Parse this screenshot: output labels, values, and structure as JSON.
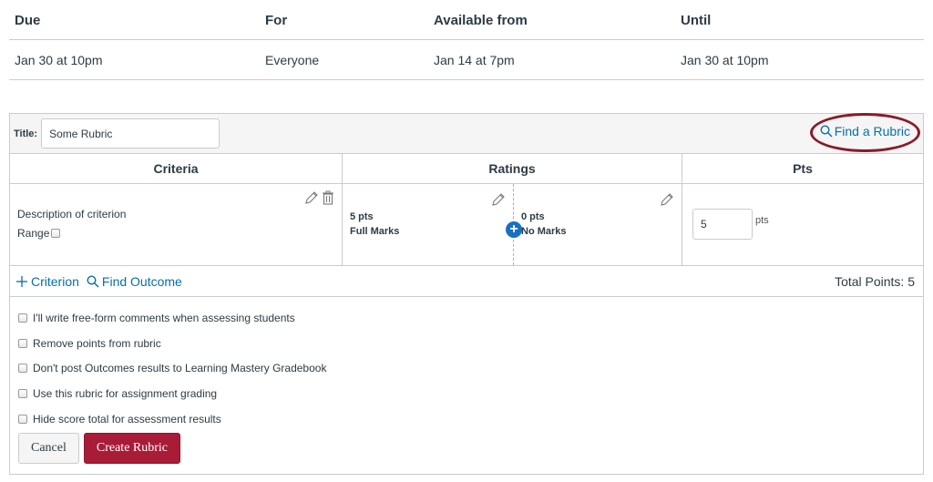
{
  "dates": {
    "headers": {
      "due": "Due",
      "for": "For",
      "available_from": "Available from",
      "until": "Until"
    },
    "row": {
      "due": "Jan 30 at 10pm",
      "for": "Everyone",
      "available_from": "Jan 14 at 7pm",
      "until": "Jan 30 at 10pm"
    }
  },
  "rubric": {
    "title_label": "Title:",
    "title_value": "Some Rubric",
    "find_rubric": "Find a Rubric",
    "columns": {
      "criteria": "Criteria",
      "ratings": "Ratings",
      "pts": "Pts"
    },
    "criterion": {
      "description": "Description of criterion",
      "range_label": "Range",
      "ratings": [
        {
          "pts": "5 pts",
          "label": "Full Marks"
        },
        {
          "pts": "0 pts",
          "label": "No Marks"
        }
      ],
      "points_value": "5",
      "points_unit": "pts"
    },
    "add_criterion": "Criterion",
    "find_outcome": "Find Outcome",
    "total_points": "Total Points: 5",
    "options": [
      "I'll write free-form comments when assessing students",
      "Remove points from rubric",
      "Don't post Outcomes results to Learning Mastery Gradebook",
      "Use this rubric for assignment grading",
      "Hide score total for assessment results"
    ],
    "cancel": "Cancel",
    "create": "Create Rubric"
  },
  "colors": {
    "link": "#0770a3",
    "primary_button": "#a81c38",
    "highlight": "#8b1a2a",
    "add_rating": "#1870c4"
  },
  "icons": [
    "search-icon",
    "pencil-icon",
    "trash-icon",
    "plus-circle-icon",
    "plus-icon"
  ]
}
